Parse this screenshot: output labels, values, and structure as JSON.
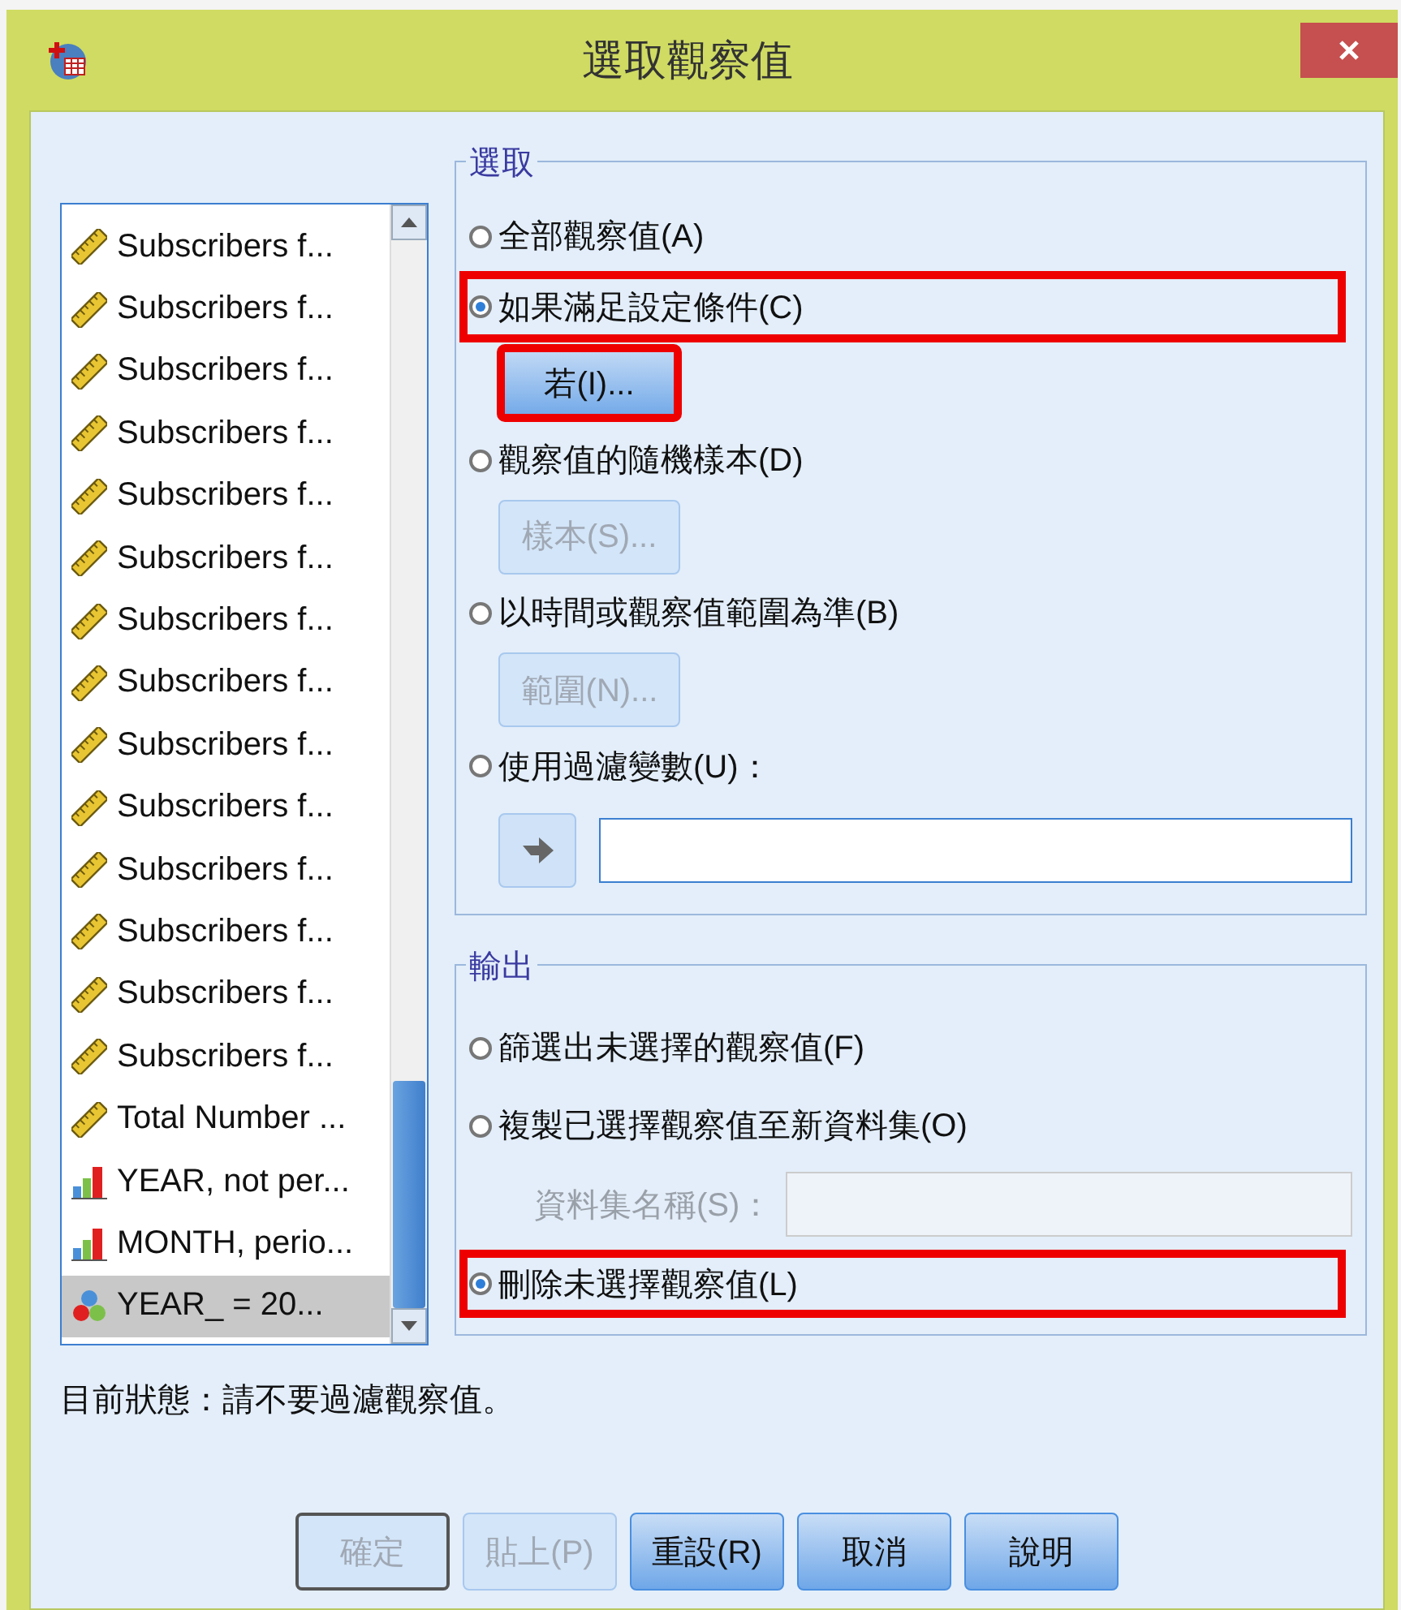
{
  "window": {
    "title": "選取觀察值"
  },
  "variables": [
    {
      "label": "Subscribers f...",
      "kind": "scale",
      "selected": false
    },
    {
      "label": "Subscribers f...",
      "kind": "scale",
      "selected": false
    },
    {
      "label": "Subscribers f...",
      "kind": "scale",
      "selected": false
    },
    {
      "label": "Subscribers f...",
      "kind": "scale",
      "selected": false
    },
    {
      "label": "Subscribers f...",
      "kind": "scale",
      "selected": false
    },
    {
      "label": "Subscribers f...",
      "kind": "scale",
      "selected": false
    },
    {
      "label": "Subscribers f...",
      "kind": "scale",
      "selected": false
    },
    {
      "label": "Subscribers f...",
      "kind": "scale",
      "selected": false
    },
    {
      "label": "Subscribers f...",
      "kind": "scale",
      "selected": false
    },
    {
      "label": "Subscribers f...",
      "kind": "scale",
      "selected": false
    },
    {
      "label": "Subscribers f...",
      "kind": "scale",
      "selected": false
    },
    {
      "label": "Subscribers f...",
      "kind": "scale",
      "selected": false
    },
    {
      "label": "Subscribers f...",
      "kind": "scale",
      "selected": false
    },
    {
      "label": "Subscribers f...",
      "kind": "scale",
      "selected": false
    },
    {
      "label": "Total Number ...",
      "kind": "scale",
      "selected": false
    },
    {
      "label": "YEAR, not per...",
      "kind": "ordinal",
      "selected": false
    },
    {
      "label": "MONTH, perio...",
      "kind": "ordinal",
      "selected": false
    },
    {
      "label": "YEAR_  =  20...",
      "kind": "nominal",
      "selected": true
    }
  ],
  "selection": {
    "legend": "選取",
    "options": [
      {
        "label": "全部觀察值(A)",
        "selected": false,
        "highlighted": false
      },
      {
        "label": "如果滿足設定條件(C)",
        "selected": true,
        "highlighted": true,
        "button": {
          "label": "若(I)...",
          "disabled": false,
          "highlighted": true
        }
      },
      {
        "label": "觀察值的隨機樣本(D)",
        "selected": false,
        "highlighted": false,
        "button": {
          "label": "樣本(S)...",
          "disabled": true,
          "highlighted": false
        }
      },
      {
        "label": "以時間或觀察值範圍為準(B)",
        "selected": false,
        "highlighted": false,
        "button": {
          "label": "範圍(N)...",
          "disabled": true,
          "highlighted": false
        }
      },
      {
        "label": "使用過濾變數(U)：",
        "selected": false,
        "highlighted": false,
        "picker": true
      }
    ]
  },
  "output": {
    "legend": "輸出",
    "options": [
      {
        "label": "篩選出未選擇的觀察值(F)",
        "selected": false,
        "highlighted": false
      },
      {
        "label": "複製已選擇觀察值至新資料集(O)",
        "selected": false,
        "highlighted": false,
        "dataset": {
          "label": "資料集名稱(S)：",
          "disabled": true
        }
      },
      {
        "label": "刪除未選擇觀察值(L)",
        "selected": true,
        "highlighted": true
      }
    ]
  },
  "status": "目前狀態：請不要過濾觀察值。",
  "buttons": [
    {
      "label": "確定",
      "disabled": true,
      "default": true
    },
    {
      "label": "貼上(P)",
      "disabled": true,
      "default": false
    },
    {
      "label": "重設(R)",
      "disabled": false,
      "default": false
    },
    {
      "label": "取消",
      "disabled": false,
      "default": false
    },
    {
      "label": "說明",
      "disabled": false,
      "default": false
    }
  ]
}
